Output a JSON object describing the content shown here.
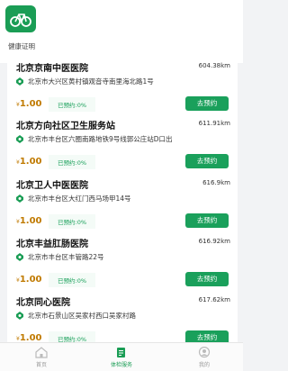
{
  "header": {
    "logo": "bicycle-icon",
    "section_label": "健康证明"
  },
  "colors": {
    "brand": "#1a9d55",
    "button": "#1aa05b",
    "price": "#c07a00"
  },
  "hospitals": [
    {
      "name": "北京京南中医医院",
      "distance": "604.38km",
      "address": "北京市大兴区黄村镇观音寺南里海北路1号",
      "price_symbol": "¥",
      "price": "1.00",
      "booked": "已预约:0%",
      "button": "去预约"
    },
    {
      "name": "北京方向社区卫生服务站",
      "distance": "611.91km",
      "address": "北京市丰台区六圈南路地铁9号线郭公庄站D口出",
      "price_symbol": "¥",
      "price": "1.00",
      "booked": "已预约:0%",
      "button": "去预约"
    },
    {
      "name": "北京卫人中医医院",
      "distance": "616.9km",
      "address": "北京市丰台区大红门西马场甲14号",
      "price_symbol": "¥",
      "price": "1.00",
      "booked": "已预约:0%",
      "button": "去预约"
    },
    {
      "name": "北京丰益肛肠医院",
      "distance": "616.92km",
      "address": "北京市丰台区丰管路22号",
      "price_symbol": "¥",
      "price": "1.00",
      "booked": "已预约:0%",
      "button": "去预约"
    },
    {
      "name": "北京同心医院",
      "distance": "617.62km",
      "address": "北京市石景山区吴家村西口吴家村路",
      "price_symbol": "¥",
      "price": "1.00",
      "booked": "已预约:0%",
      "button": "去预约"
    }
  ],
  "tabbar": [
    {
      "label": "首页",
      "icon": "home-icon",
      "active": false
    },
    {
      "label": "体检服务",
      "icon": "clipboard-icon",
      "active": true
    },
    {
      "label": "我的",
      "icon": "user-icon",
      "active": false
    }
  ]
}
